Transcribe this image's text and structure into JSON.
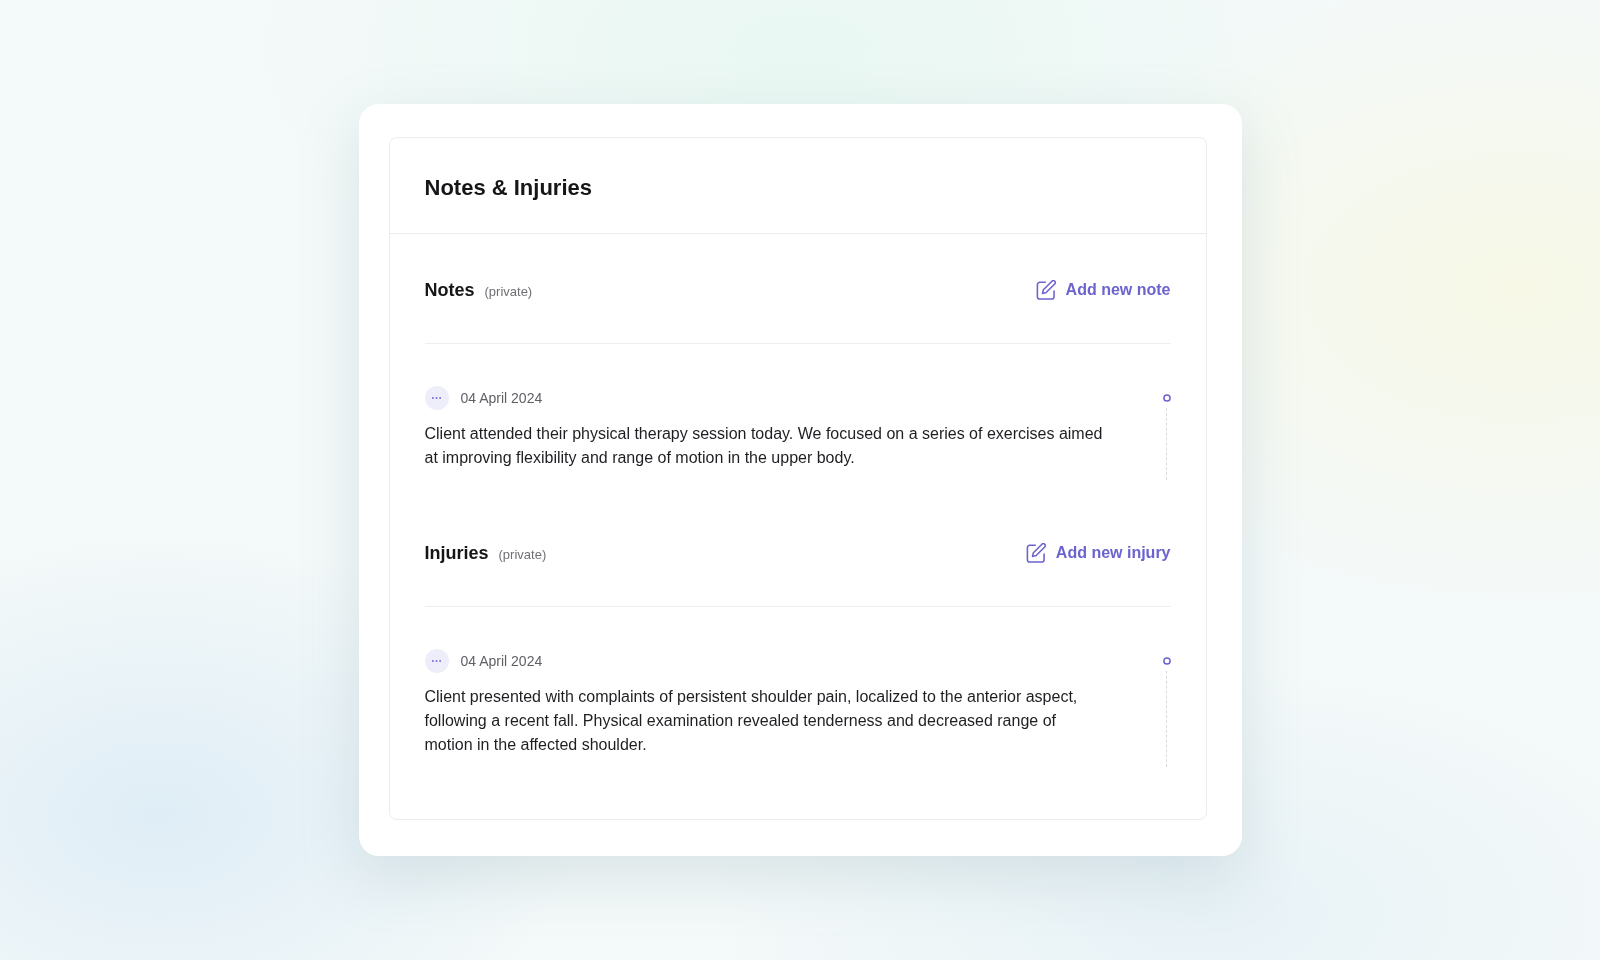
{
  "card": {
    "title": "Notes & Injuries"
  },
  "sections": [
    {
      "title": "Notes",
      "note": "(private)",
      "action": "Add new note",
      "entries": [
        {
          "date": "04 April 2024",
          "text": "Client attended their physical therapy session today. We focused on a series of exercises aimed at improving flexibility and range of motion in the upper body."
        }
      ]
    },
    {
      "title": "Injuries",
      "note": "(private)",
      "action": "Add new injury",
      "entries": [
        {
          "date": "04 April 2024",
          "text": "Client presented with complaints of persistent shoulder pain, localized to the anterior aspect, following a recent fall. Physical examination revealed tenderness and decreased range of motion in the affected shoulder."
        }
      ]
    }
  ]
}
